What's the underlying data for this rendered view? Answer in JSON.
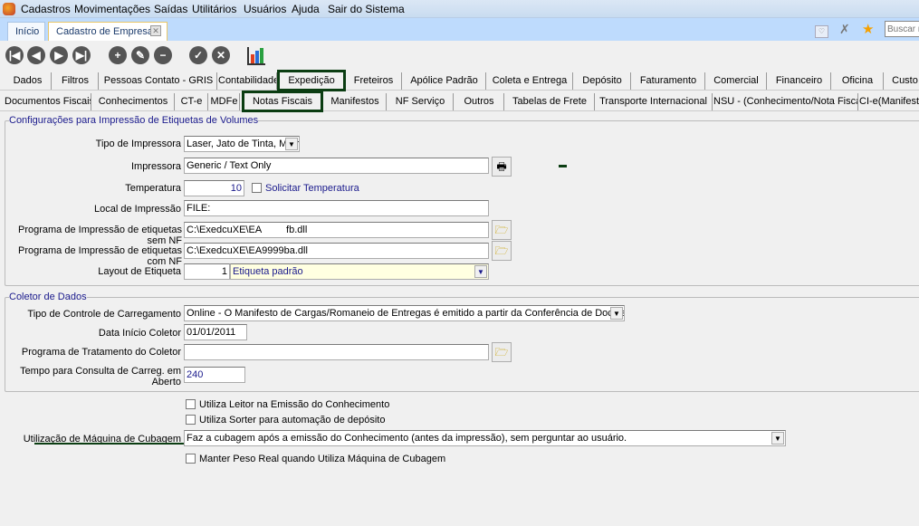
{
  "menu": [
    "Cadastros",
    "Movimentações",
    "Saídas",
    "Utilitários",
    "Usuários",
    "Ajuda",
    "Sair do Sistema"
  ],
  "doc_tabs": [
    "Início",
    "Cadastro de Empresas"
  ],
  "search_placeholder": "Buscar m",
  "toolbar": [
    "first-icon",
    "prev-icon",
    "next-icon",
    "last-icon",
    "add-icon",
    "edit-icon",
    "remove-icon",
    "confirm-icon",
    "cancel-icon",
    "chart-icon"
  ],
  "tabs1": [
    "Dados",
    "Filtros",
    "Pessoas Contato - GRIS",
    "Contabilidade",
    "Expedição",
    "Freteiros",
    "Apólice Padrão",
    "Coleta e Entrega",
    "Depósito",
    "Faturamento",
    "Comercial",
    "Financeiro",
    "Oficina",
    "Custo"
  ],
  "tabs2": [
    "Documentos Fiscais",
    "Conhecimentos",
    "CT-e",
    "MDFe",
    "Notas Fiscais",
    "Manifestos",
    "NF Serviço",
    "Outros",
    "Tabelas de Frete",
    "Transporte Internacional",
    "NSU - (Conhecimento/Nota Fiscal)",
    "CI-e(Manifesto"
  ],
  "selected_tab1": "Expedição",
  "selected_tab2": "Notas Fiscais",
  "etiquetas": {
    "legend": "Configurações para Impressão de Etiquetas de Volumes",
    "tipo_label": "Tipo de Impressora",
    "tipo_value": "Laser, Jato de Tinta, Matr",
    "impressora_label": "Impressora",
    "impressora_value": "Generic / Text Only",
    "temperatura_label": "Temperatura",
    "temperatura_value": "10",
    "solicitar_label": "Solicitar Temperatura",
    "solicitar_checked": false,
    "local_label": "Local de Impressão",
    "local_value": "FILE:",
    "sem_nf_label": "Programa de Impressão de etiquetas sem NF",
    "sem_nf_value": "C:\\ExedcuXE\\EA         fb.dll",
    "com_nf_label": "Programa de Impressão de etiquetas com NF",
    "com_nf_value": "C:\\ExedcuXE\\EA9999ba.dll",
    "layout_label": "Layout de Etiqueta",
    "layout_num": "1",
    "layout_value": "Etiqueta padrão"
  },
  "coletor": {
    "legend": "Coletor de Dados",
    "tipo_label": "Tipo de Controle de Carregamento",
    "tipo_value": "Online - O Manifesto de Cargas/Romaneio de Entregas é emitido a partir da Conferência de Doctos do Contro",
    "data_label": "Data Início Coletor",
    "data_value": "01/01/2011",
    "programa_label": "Programa de Tratamento do Coletor",
    "programa_value": "",
    "tempo_label": "Tempo para Consulta de Carreg. em Aberto",
    "tempo_value": "240"
  },
  "options": {
    "leitor_label": "Utiliza Leitor na Emissão do Conhecimento",
    "leitor_checked": false,
    "sorter_label": "Utiliza Sorter para automação de depósito",
    "sorter_checked": false,
    "cubagem_label": "Utilização de Máquina de Cubagem",
    "cubagem_value": "Faz a cubagem após a emissão do Conhecimento (antes da impressão), sem perguntar ao usuário.",
    "peso_label": "Manter Peso Real quando Utiliza Máquina de Cubagem",
    "peso_checked": false
  },
  "colors": {
    "highlight": "#0b3d12",
    "link_text": "#1a1a8c",
    "tab_bar": "#bedbfd"
  }
}
